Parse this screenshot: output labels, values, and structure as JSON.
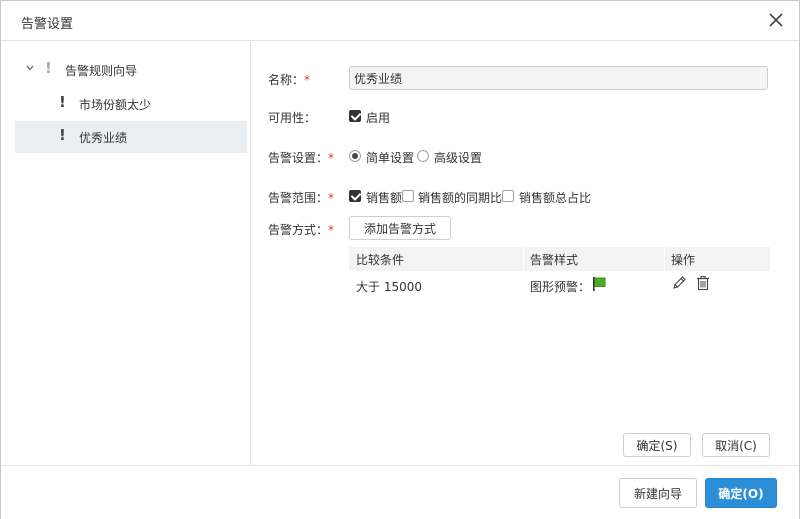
{
  "dialog": {
    "title": "告警设置"
  },
  "tree": {
    "root": {
      "label": "告警规则向导"
    },
    "children": [
      {
        "label": "市场份额太少"
      },
      {
        "label": "优秀业绩"
      }
    ]
  },
  "form": {
    "name": {
      "label": "名称：",
      "required_mark": "*",
      "value": "优秀业绩"
    },
    "availability": {
      "label": "可用性：",
      "option_label": "启用",
      "checked": true
    },
    "alert_setting": {
      "label": "告警设置：",
      "required_mark": "*",
      "options": [
        {
          "label": "简单设置",
          "selected": true
        },
        {
          "label": "高级设置",
          "selected": false
        }
      ]
    },
    "alert_scope": {
      "label": "告警范围：",
      "required_mark": "*",
      "options": [
        {
          "label": "销售额",
          "checked": true
        },
        {
          "label": "销售额的同期比",
          "checked": false
        },
        {
          "label": "销售额总占比",
          "checked": false
        }
      ]
    },
    "alert_method": {
      "label": "告警方式：",
      "required_mark": "*",
      "add_button": "添加告警方式"
    }
  },
  "table": {
    "columns": [
      "比较条件",
      "告警样式",
      "操作"
    ],
    "rows": [
      {
        "condition": "大于 15000",
        "style": "图形预警：",
        "flag_color": "#4caf22"
      }
    ]
  },
  "inner_buttons": {
    "ok": "确定(S)",
    "cancel": "取消(C)"
  },
  "footer": {
    "new_wizard": "新建向导",
    "confirm": "确定(O)"
  },
  "colors": {
    "primary": "#2b8ed6",
    "required": "#e53935",
    "selected_row": "#eaeef3"
  }
}
